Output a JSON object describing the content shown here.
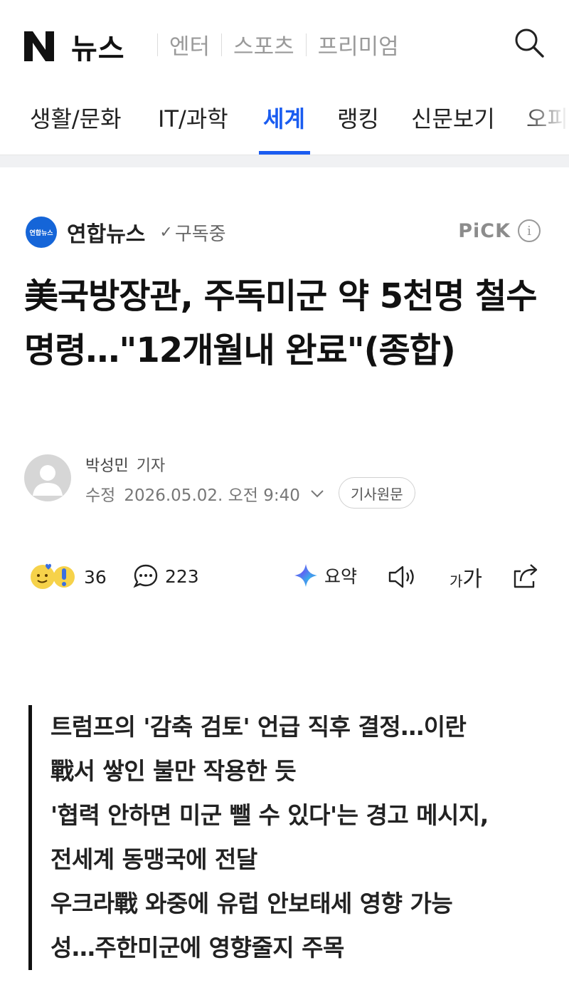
{
  "header": {
    "logo_letter": "N",
    "logo_text": "뉴스",
    "top_tabs": [
      "엔터",
      "스포츠",
      "프리미엄"
    ]
  },
  "category_nav": {
    "items": [
      "생활/문화",
      "IT/과학",
      "세계",
      "랭킹",
      "신문보기",
      "오피"
    ],
    "active": "세계",
    "accent_color": "#1a5cf0"
  },
  "press": {
    "logo_text": "연합뉴스",
    "name": "연합뉴스",
    "subscribe_label": "구독중",
    "pick_label": "PiCK",
    "info_symbol": "i"
  },
  "article": {
    "headline": "美국방장관, 주독미군 약 5천명 철수 명령…\"12개월내 완료\"(종합)",
    "reporter_name": "박성민",
    "reporter_role": "기자",
    "date_label": "수정",
    "date_value": "2026.05.02. 오전 9:40",
    "original_button": "기사원문"
  },
  "actions": {
    "reaction_count": "36",
    "comment_count": "223",
    "summary_label": "요약",
    "font_label_small": "가",
    "font_label_large": "가"
  },
  "summary": {
    "lines": [
      "트럼프의 '감축 검토' 언급 직후 결정…이란",
      "戰서 쌓인 불만 작용한 듯",
      "'협력 안하면 미군 뺄 수 있다'는 경고 메시지,",
      "전세계 동맹국에 전달",
      "우크라戰 와중에 유럽 안보태세 영향 가능",
      "성…주한미군에 영향줄지 주목"
    ]
  }
}
